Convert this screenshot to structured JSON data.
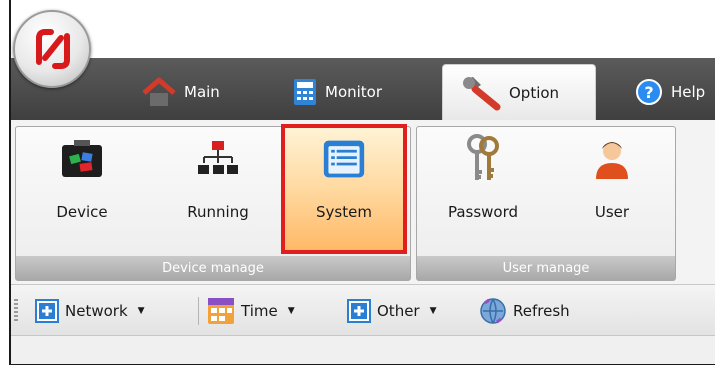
{
  "tabs": [
    {
      "label": "Main",
      "icon": "house-icon",
      "active": false
    },
    {
      "label": "Monitor",
      "icon": "calculator-icon",
      "active": false
    },
    {
      "label": "Option",
      "icon": "wrench-icon",
      "active": true
    },
    {
      "label": "Help",
      "icon": "help-icon",
      "active": false
    }
  ],
  "ribbon": {
    "device_group": {
      "caption": "Device manage",
      "buttons": [
        {
          "label": "Device",
          "icon": "device-box-icon"
        },
        {
          "label": "Running",
          "icon": "network-hierarchy-icon"
        },
        {
          "label": "System",
          "icon": "system-list-icon",
          "selected": true
        }
      ]
    },
    "user_group": {
      "caption": "User manage",
      "buttons": [
        {
          "label": "Password",
          "icon": "keys-icon"
        },
        {
          "label": "User",
          "icon": "user-icon"
        }
      ]
    }
  },
  "toolbar": {
    "items": [
      {
        "label": "Network",
        "icon": "add-icon",
        "dropdown": true
      },
      {
        "label": "Time",
        "icon": "calendar-icon",
        "dropdown": true
      },
      {
        "label": "Other",
        "icon": "add-icon",
        "dropdown": true
      },
      {
        "label": "Refresh",
        "icon": "globe-refresh-icon",
        "dropdown": false
      }
    ]
  },
  "colors": {
    "tabbar": "#4a4a4a",
    "highlight": "#e11e1e",
    "selected_fill": "#ffb866",
    "accent_blue": "#2a7fd4"
  }
}
